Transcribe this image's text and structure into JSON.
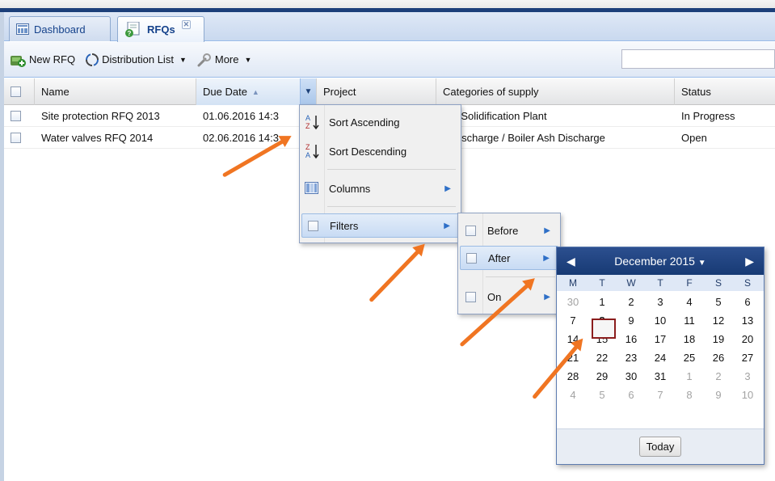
{
  "tabs": [
    {
      "label": "Dashboard",
      "icon": "dashboard-icon",
      "active": false
    },
    {
      "label": "RFQs",
      "icon": "rfq-icon",
      "active": true,
      "close": "✕"
    }
  ],
  "toolbar": {
    "new_rfq": "New RFQ",
    "distribution_list": "Distribution List",
    "more": "More",
    "search_value": ""
  },
  "grid": {
    "headers": [
      "Name",
      "Due Date",
      "Project",
      "Categories of supply",
      "Status"
    ],
    "rows": [
      {
        "name": "Site protection RFQ 2013",
        "due": "01.06.2016 14:3",
        "category": "CR Solidification Plant",
        "status": "In Progress"
      },
      {
        "name": "Water valves RFQ 2014",
        "due": "02.06.2016 14:3",
        "category": "h Discharge / Boiler Ash Discharge",
        "status": "Open"
      }
    ]
  },
  "column_menu": {
    "sort_asc": "Sort Ascending",
    "sort_desc": "Sort Descending",
    "columns": "Columns",
    "filters": "Filters"
  },
  "filter_menu": {
    "before": "Before",
    "after": "After",
    "on": "On"
  },
  "calendar": {
    "month": "December 2015",
    "days": [
      "M",
      "T",
      "W",
      "T",
      "F",
      "S",
      "S"
    ],
    "weeks": [
      [
        "30",
        "1",
        "2",
        "3",
        "4",
        "5",
        "6"
      ],
      [
        "7",
        "8",
        "9",
        "10",
        "11",
        "12",
        "13"
      ],
      [
        "14",
        "15",
        "16",
        "17",
        "18",
        "19",
        "20"
      ],
      [
        "21",
        "22",
        "23",
        "24",
        "25",
        "26",
        "27"
      ],
      [
        "28",
        "29",
        "30",
        "31",
        "1",
        "2",
        "3"
      ],
      [
        "4",
        "5",
        "6",
        "7",
        "8",
        "9",
        "10"
      ]
    ],
    "selected": "8",
    "today": "Today"
  },
  "colors": {
    "accent": "#15428b",
    "header": "#173a74",
    "annotation": "#f07522"
  }
}
